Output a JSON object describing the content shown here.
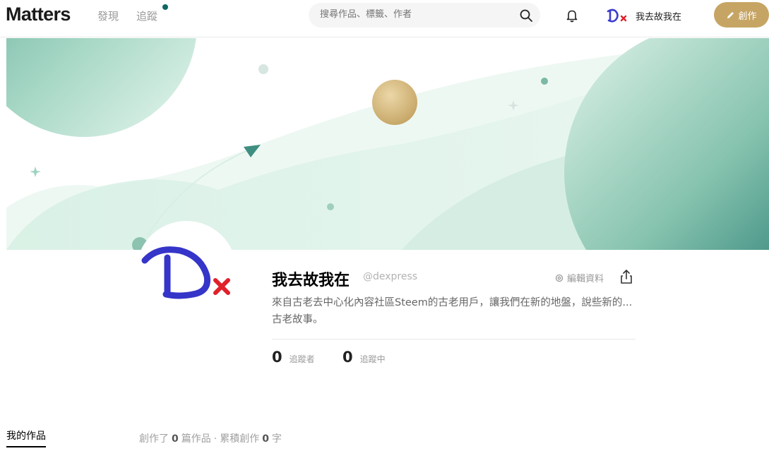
{
  "header": {
    "logo": "Matters",
    "nav": {
      "discover": "發現",
      "follow": "追蹤"
    },
    "search": {
      "placeholder": "搜尋作品、標籤、作者"
    },
    "user": {
      "name": "我去故我在"
    },
    "create_label": "創作"
  },
  "profile": {
    "name": "我去故我在",
    "handle": "@dexpress",
    "edit_label": "編輯資料",
    "bio": "來自古老去中心化內容社區Steem的古老用戶，讓我們在新的地盤，說些新的...古老故事。",
    "followers": {
      "count": "0",
      "label": "追蹤者"
    },
    "following": {
      "count": "0",
      "label": "追蹤中"
    }
  },
  "tabs": {
    "works_label": "我的作品",
    "summary": {
      "prefix": "創作了",
      "articles": "0",
      "articles_unit": "篇作品",
      "sep": "·",
      "words_prefix": "累積創作",
      "words": "0",
      "words_unit": "字"
    }
  },
  "colors": {
    "accent": "#0d6763",
    "gold": "#c6a564",
    "cover_light": "#d7efe6",
    "cover_dark": "#0d6763"
  },
  "icons": [
    "search-icon",
    "bell-icon",
    "pencil-icon",
    "gear-icon",
    "share-icon"
  ]
}
